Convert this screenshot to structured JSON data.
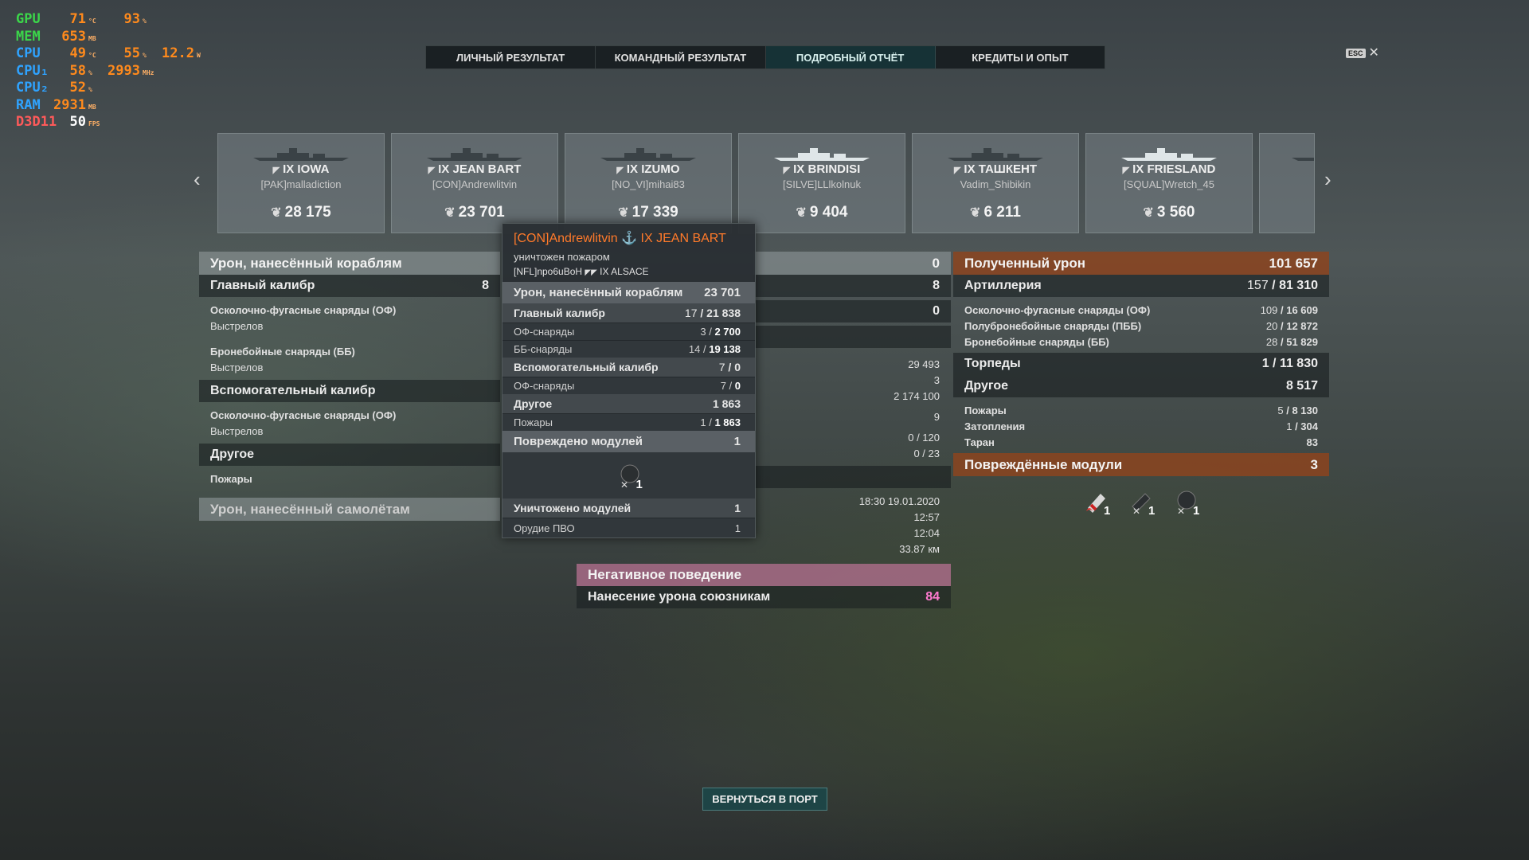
{
  "overlay": [
    {
      "label": "GPU",
      "color": "#3bd64a",
      "v1": "71",
      "u1": "°C",
      "v2": "93",
      "u2": "%"
    },
    {
      "label": "MEM",
      "color": "#3bd64a",
      "v1": "653",
      "u1": "MB"
    },
    {
      "label": "CPU",
      "color": "#2fa3ff",
      "v1": "49",
      "u1": "°C",
      "v2": "55",
      "u2": "%",
      "v3": "12.2",
      "u3": "W"
    },
    {
      "label": "CPU₁",
      "color": "#2fa3ff",
      "v1": "58",
      "u1": "%",
      "v2": "2993",
      "u2": "MHz"
    },
    {
      "label": "CPU₂",
      "color": "#2fa3ff",
      "v1": "52",
      "u1": "%"
    },
    {
      "label": "RAM",
      "color": "#2fa3ff",
      "v1": "2931",
      "u1": "MB"
    },
    {
      "label": "D3D11",
      "color": "#ff5a5a",
      "v1": "50",
      "u1": "FPS",
      "v1color": "#ffffff"
    }
  ],
  "tabs": [
    "ЛИЧНЫЙ РЕЗУЛЬТАТ",
    "КОМАНДНЫЙ РЕЗУЛЬТАТ",
    "ПОДРОБНЫЙ ОТЧЁТ",
    "КРЕДИТЫ И ОПЫТ"
  ],
  "esc": {
    "key": "ESC",
    "close": "✕"
  },
  "cards": [
    {
      "name": "IX IOWA",
      "player": "[PAK]malladiction",
      "score": "28 175"
    },
    {
      "name": "IX JEAN BART",
      "player": "[CON]Andrewlitvin",
      "score": "23 701"
    },
    {
      "name": "IX IZUMO",
      "player": "[NO_VI]mihai83",
      "score": "17 339"
    },
    {
      "name": "IX BRINDISI",
      "player": "[SILVE]LLlkolnuk",
      "score": "9 404"
    },
    {
      "name": "IX ТАШКЕНТ",
      "player": "Vadim_Shibikin",
      "score": "6 211"
    },
    {
      "name": "IX FRIESLAND",
      "player": "[SQUAL]Wretch_45",
      "score": "3 560"
    }
  ],
  "left": {
    "header": "Урон, нанесённый кораблям",
    "main_caliber": "Главный калибр",
    "main_caliber_partial": "8",
    "he": "Осколочно-фугасные снаряды (ОФ)",
    "shots1": "Выстрелов",
    "ap": "Бронебойные снаряды (ББ)",
    "shots2": "Выстрелов",
    "secondary": "Вспомогательный калибр",
    "he2": "Осколочно-фугасные снаряды (ОФ)",
    "shots3": "Выстрелов",
    "other": "Другое",
    "fires": "Пожары",
    "planes": "Урон, нанесённый самолётам"
  },
  "middle": {
    "v0": "0",
    "v1": "8",
    "v2": "0",
    "vals": [
      "29 493",
      "3",
      "2 174 100",
      "9",
      "0 / 120",
      "0 / 23"
    ],
    "times": [
      "18:30  19.01.2020",
      "12:57",
      "12:04",
      "33.87 км"
    ],
    "negative": "Негативное поведение",
    "team_damage": "Нанесение урона союзникам",
    "team_damage_val": "84"
  },
  "right": {
    "received": "Полученный урон",
    "received_val": "101 657",
    "artillery": "Артиллерия",
    "art_a": "157",
    "art_b": "81 310",
    "rows1": [
      {
        "label": "Осколочно-фугасные снаряды (ОФ)",
        "a": "109",
        "b": "16 609"
      },
      {
        "label": "Полубронебойные снаряды (ПББ)",
        "a": "20",
        "b": "12 872"
      },
      {
        "label": "Бронебойные снаряды (ББ)",
        "a": "28",
        "b": "51 829"
      }
    ],
    "torpedoes": "Торпеды",
    "torp_a": "1",
    "torp_b": "11 830",
    "other": "Другое",
    "other_val": "8 517",
    "rows2": [
      {
        "label": "Пожары",
        "a": "5",
        "b": "8 130"
      },
      {
        "label": "Затопления",
        "a": "1",
        "b": "304"
      },
      {
        "label": "Таран",
        "a": "",
        "b": "83"
      }
    ],
    "modules": "Повреждённые модули",
    "modules_val": "3",
    "module_counts": [
      "1",
      "1",
      "1"
    ]
  },
  "tooltip": {
    "player": "[CON]Andrewlitvin",
    "ship": "IX JEAN BART",
    "killed": "уничтожен пожаром",
    "killer": "[NFL]npo6uBoH",
    "killer_ship": "IX ALSACE",
    "dmg": "Урон, нанесённый кораблям",
    "dmg_val": "23 701",
    "main": "Главный калибр",
    "main_a": "17",
    "main_b": "21 838",
    "he": "ОФ-снаряды",
    "he_a": "3",
    "he_b": "2 700",
    "ap": "ББ-снаряды",
    "ap_a": "14",
    "ap_b": "19 138",
    "sec": "Вспомогательный калибр",
    "sec_a": "7",
    "sec_b": "0",
    "sec_he": "ОФ-снаряды",
    "sec_he_a": "7",
    "sec_he_b": "0",
    "other": "Другое",
    "other_val": "1 863",
    "fires": "Пожары",
    "fires_a": "1",
    "fires_b": "1 863",
    "damaged": "Повреждено модулей",
    "damaged_val": "1",
    "damaged_icon_count": "1",
    "destroyed": "Уничтожено модулей",
    "destroyed_val": "1",
    "aa": "Орудие ПВО",
    "aa_val": "1"
  },
  "back_button": "ВЕРНУТЬСЯ В ПОРТ"
}
